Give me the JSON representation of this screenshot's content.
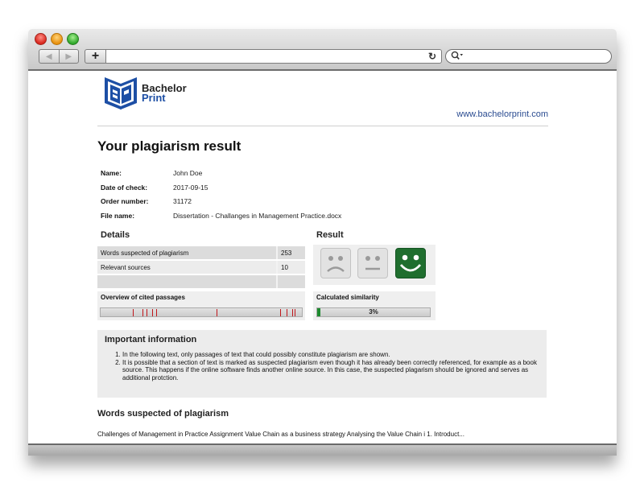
{
  "browser": {
    "nav_back_icon": "triangle-left",
    "nav_forward_icon": "triangle-right",
    "add_tab_label": "+",
    "url_value": "",
    "reload_icon": "↻",
    "search_icon": "magnifier-with-dropdown",
    "search_value": ""
  },
  "header": {
    "brand_line1": "Bachelor",
    "brand_line2": "Print",
    "website": "www.bachelorprint.com",
    "brand_color": "#1d4fa5"
  },
  "page_title": "Your plagiarism result",
  "meta": [
    {
      "label": "Name:",
      "value": "John Doe"
    },
    {
      "label": "Date of check:",
      "value": "2017-09-15"
    },
    {
      "label": "Order number:",
      "value": "31172"
    },
    {
      "label": "File name:",
      "value": "Dissertation - Challanges in Management Practice.docx"
    }
  ],
  "details": {
    "title": "Details",
    "rows": [
      {
        "label": "Words suspected of plagiarism",
        "value": "253"
      },
      {
        "label": "Relevant sources",
        "value": "10"
      },
      {
        "label": "",
        "value": ""
      }
    ],
    "cited_title": "Overview of cited passages",
    "cited_marks": [
      0.16,
      0.21,
      0.23,
      0.26,
      0.28,
      0.58,
      0.9,
      0.93,
      0.96,
      0.97
    ],
    "mark_color": "#c0161b"
  },
  "result": {
    "title": "Result",
    "faces": [
      {
        "name": "sad",
        "active": false
      },
      {
        "name": "neutral",
        "active": false
      },
      {
        "name": "happy",
        "active": true
      }
    ],
    "active_color": "#1f6e2e",
    "similarity_title": "Calculated similarity",
    "similarity_percent": 3,
    "similarity_label": "3%"
  },
  "info": {
    "title": "Important information",
    "items": [
      "In the following text, only passages of text that could possibly constitute plagiarism are shown.",
      "It is possible that a section of text is marked as suspected plagiarism even though it has already been correctly referenced, for example as a book source. This happens if the online software finds another online source. In this case, the suspected plagarism should be ignored and serves as additional protction."
    ]
  },
  "words_section": {
    "title": "Words suspected of plagiarism",
    "excerpt": "Challenges of Management in Practice Assignment Value Chain as a business strategy Analysing the Value Chain i 1. Introduct..."
  }
}
